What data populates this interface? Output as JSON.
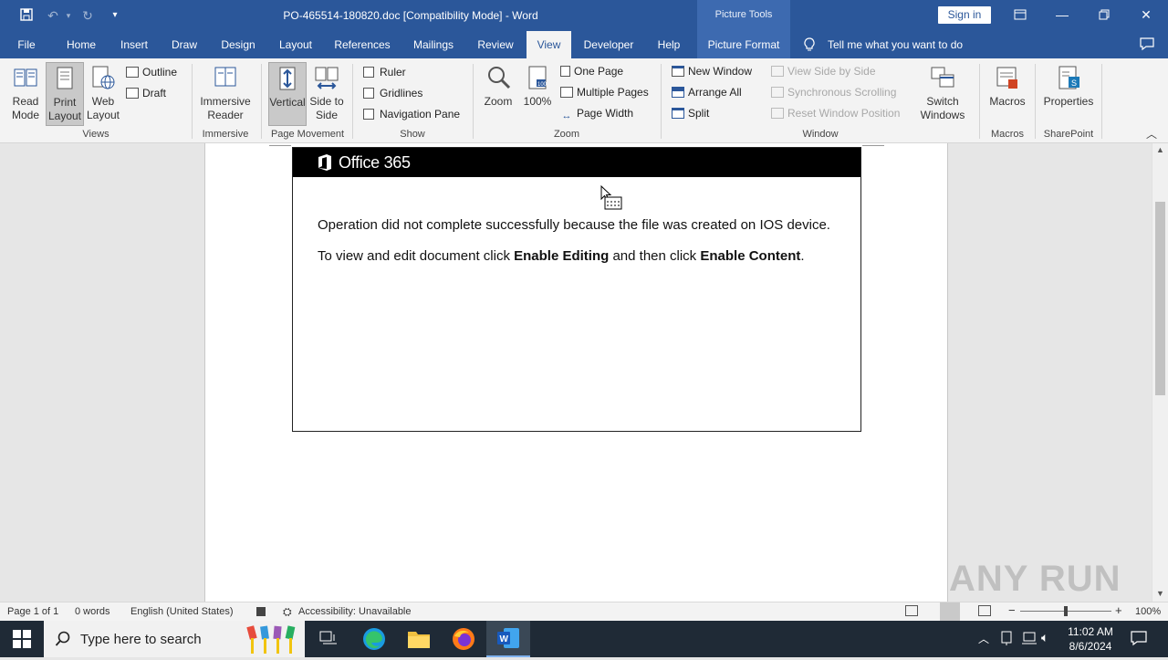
{
  "title_bar": {
    "doc_title": "PO-465514-180820.doc [Compatibility Mode]  -  Word",
    "context_tools": "Picture Tools",
    "sign_in": "Sign in"
  },
  "tabs": [
    "File",
    "Home",
    "Insert",
    "Draw",
    "Design",
    "Layout",
    "References",
    "Mailings",
    "Review",
    "View",
    "Developer",
    "Help",
    "Picture Format"
  ],
  "tell_me": "Tell me what you want to do",
  "ribbon": {
    "views": {
      "read_mode": "Read Mode",
      "print_layout": "Print Layout",
      "web_layout": "Web Layout",
      "outline": "Outline",
      "draft": "Draft",
      "label": "Views"
    },
    "immersive": {
      "reader": "Immersive Reader",
      "label": "Immersive"
    },
    "page_movement": {
      "vertical": "Vertical",
      "side": "Side to Side",
      "label": "Page Movement"
    },
    "show": {
      "ruler": "Ruler",
      "gridlines": "Gridlines",
      "nav_pane": "Navigation Pane",
      "label": "Show"
    },
    "zoom": {
      "zoom": "Zoom",
      "hundred": "100%",
      "one_page": "One Page",
      "multiple_pages": "Multiple Pages",
      "page_width": "Page Width",
      "label": "Zoom"
    },
    "window": {
      "new_window": "New Window",
      "arrange_all": "Arrange All",
      "split": "Split",
      "side_by_side": "View Side by Side",
      "sync_scroll": "Synchronous Scrolling",
      "reset_pos": "Reset Window Position",
      "switch": "Switch Windows",
      "label": "Window"
    },
    "macros": {
      "macros": "Macros",
      "label": "Macros"
    },
    "sharepoint": {
      "properties": "Properties",
      "label": "SharePoint"
    }
  },
  "document": {
    "brand": "Office 365",
    "line1": "Operation did not complete successfully because the file was created on IOS device.",
    "line2_pre": "To view and edit document click ",
    "line2_b1": "Enable Editing",
    "line2_mid": " and then click ",
    "line2_b2": "Enable Content",
    "line2_end": "."
  },
  "status": {
    "page": "Page 1 of 1",
    "words": "0 words",
    "language": "English (United States)",
    "accessibility": "Accessibility: Unavailable",
    "zoom": "100%"
  },
  "taskbar": {
    "search_placeholder": "Type here to search",
    "time": "11:02 AM",
    "date": "8/6/2024"
  },
  "watermark": "ANY RUN",
  "colors": {
    "word_blue": "#2b579a",
    "taskbar": "#1f2a36"
  }
}
